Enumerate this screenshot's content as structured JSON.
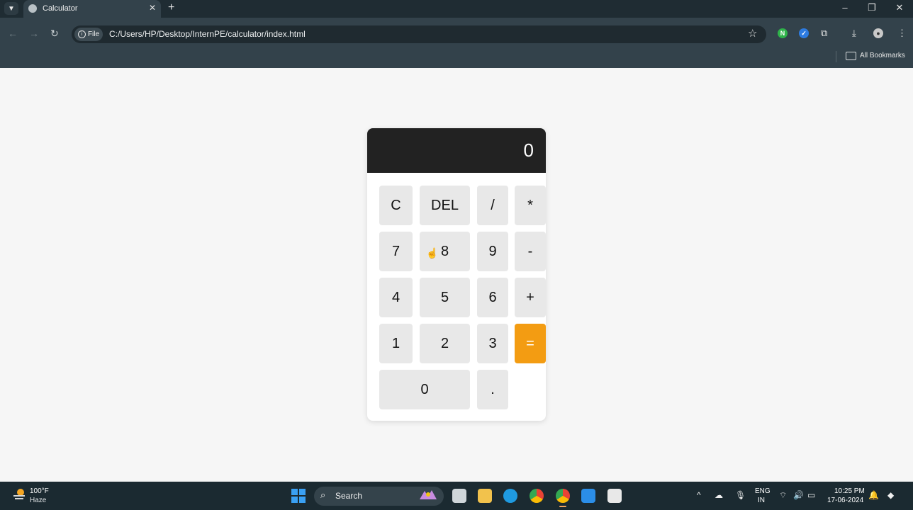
{
  "browser": {
    "tab_title": "Calculator",
    "file_chip": "File",
    "url": "C:/Users/HP/Desktop/InternPE/calculator/index.html",
    "bookmarks_label": "All Bookmarks"
  },
  "calculator": {
    "display_value": "0",
    "keys": {
      "clear": "C",
      "delete": "DEL",
      "divide": "/",
      "multiply": "*",
      "seven": "7",
      "eight": "8",
      "nine": "9",
      "minus": "-",
      "four": "4",
      "five": "5",
      "six": "6",
      "plus": "+",
      "one": "1",
      "two": "2",
      "three": "3",
      "equals": "=",
      "zero": "0",
      "decimal": "."
    },
    "colors": {
      "display_bg": "#222222",
      "key_bg": "#e8e8e8",
      "equals_bg": "#f39c12"
    }
  },
  "taskbar": {
    "weather_temp": "100°F",
    "weather_desc": "Haze",
    "search_label": "Search",
    "lang_line1": "ENG",
    "lang_line2": "IN",
    "time": "10:25 PM",
    "date": "17-06-2024"
  }
}
